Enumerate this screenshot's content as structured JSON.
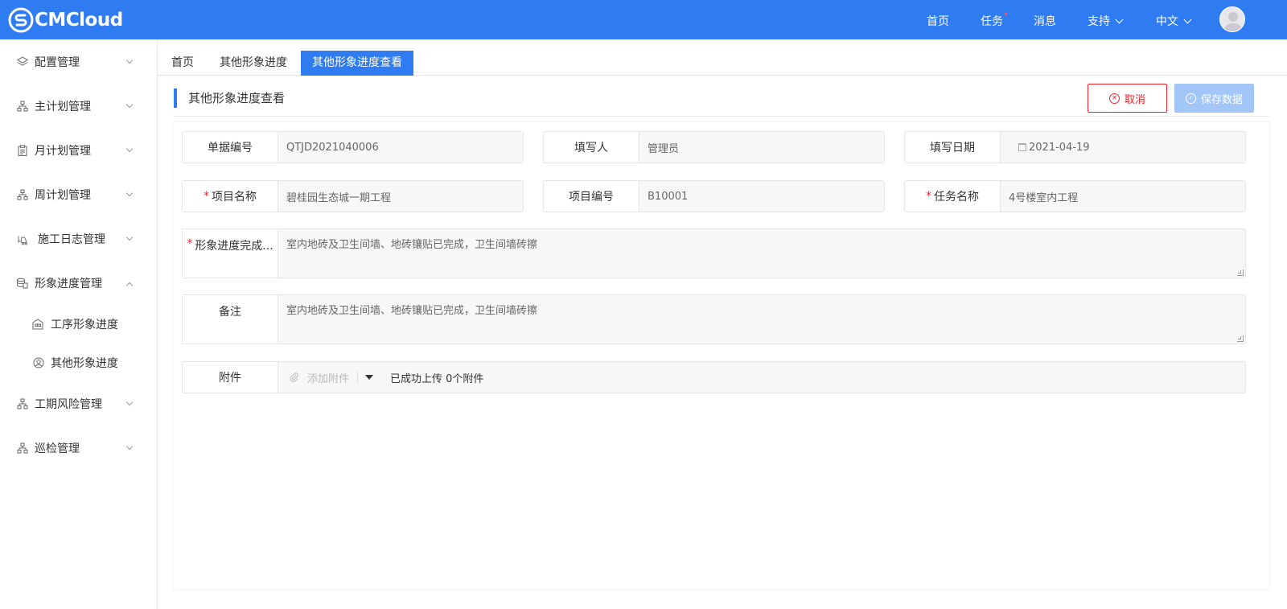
{
  "app": {
    "brand": "CMCloud",
    "colors": {
      "primary": "#2f7bf2",
      "danger": "#f5222d",
      "disabled": "#a3c6f8"
    }
  },
  "topnav": {
    "home": "首页",
    "task": "任务",
    "task_dot": "•",
    "messages": "消息",
    "support": "支持",
    "language": "中文"
  },
  "sidebar": {
    "items": [
      {
        "label": "配置管理",
        "icon": "layers-icon"
      },
      {
        "label": "主计划管理",
        "icon": "org-chart-icon"
      },
      {
        "label": "月计划管理",
        "icon": "clipboard-icon"
      },
      {
        "label": "周计划管理",
        "icon": "org-chart-icon"
      },
      {
        "label": "施工日志管理",
        "icon": "forklift-icon"
      },
      {
        "label": "形象进度管理",
        "icon": "stack-icon"
      },
      {
        "label": "工序形象进度",
        "icon": "building-icon"
      },
      {
        "label": "其他形象进度",
        "icon": "user-circle-icon"
      },
      {
        "label": "工期风险管理",
        "icon": "org-chart-icon"
      },
      {
        "label": "巡检管理",
        "icon": "org-chart-icon"
      }
    ]
  },
  "tabs": [
    {
      "label": "首页"
    },
    {
      "label": "其他形象进度"
    },
    {
      "label": "其他形象进度查看"
    }
  ],
  "page": {
    "title": "其他形象进度查看",
    "cancel_label": "取消",
    "save_label": "保存数据"
  },
  "form": {
    "doc_no": {
      "label": "单据编号",
      "value": "QTJD2021040006"
    },
    "author": {
      "label": "填写人",
      "value": "管理员"
    },
    "date": {
      "label": "填写日期",
      "value": "2021-04-19"
    },
    "project_name": {
      "label": "项目名称",
      "value": "碧桂园生态城一期工程"
    },
    "project_no": {
      "label": "项目编号",
      "value": "B10001"
    },
    "task_name": {
      "label": "任务名称",
      "value": "4号楼室内工程"
    },
    "progress": {
      "label": "形象进度完成...",
      "value": "室内地砖及卫生间墙、地砖镶贴已完成，卫生间墙砖擦"
    },
    "remark": {
      "label": "备注",
      "value": "室内地砖及卫生间墙、地砖镶贴已完成，卫生间墙砖擦"
    },
    "attachment": {
      "label": "附件",
      "add_label": "添加附件",
      "status": "已成功上传 0个附件"
    },
    "required_mark": "*"
  }
}
